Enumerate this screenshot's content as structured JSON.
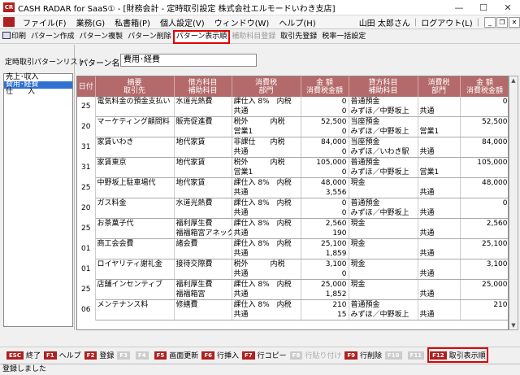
{
  "title": "CASH RADAR for SaaS① - [財務会計 - 定時取引設定 株式会社エルモードいわき支店]",
  "menu": [
    "ファイル(F)",
    "業務(G)",
    "私書箱(P)",
    "個人設定(V)",
    "ウィンドウ(W)",
    "ヘルプ(H)"
  ],
  "user": "山田 太郎さん",
  "logout": "ログアウト(L)",
  "toolbar": [
    {
      "label": "印刷",
      "state": "normal"
    },
    {
      "label": "パターン作成",
      "state": "normal"
    },
    {
      "label": "パターン複製",
      "state": "normal"
    },
    {
      "label": "パターン削除",
      "state": "normal"
    },
    {
      "label": "パターン表示順",
      "state": "highlight"
    },
    {
      "label": "補助科目登録",
      "state": "disabled"
    },
    {
      "label": "取引先登録",
      "state": "normal"
    },
    {
      "label": "税率一括設定",
      "state": "normal"
    }
  ],
  "left_panel": {
    "title": "定時取引パターンリスト",
    "items": [
      {
        "label": "売上･収入",
        "selected": false
      },
      {
        "label": "費用･経費",
        "selected": true
      },
      {
        "label": "仕　　入",
        "selected": false
      }
    ]
  },
  "pattern": {
    "label": "パターン名",
    "value": "費用･経費"
  },
  "table": {
    "headers": [
      {
        "l1": "日付",
        "l2": ""
      },
      {
        "l1": "摘要",
        "l2": "取引先"
      },
      {
        "l1": "借方科目",
        "l2": "補助科目"
      },
      {
        "l1": "消費税",
        "l2": "部門"
      },
      {
        "l1": "金 額",
        "l2": "消費税金額"
      },
      {
        "l1": "貸方科目",
        "l2": "補助科目"
      },
      {
        "l1": "消費税",
        "l2": "部門"
      },
      {
        "l1": "金 額",
        "l2": "消費税金額"
      }
    ],
    "rows": [
      {
        "day": "25",
        "a": [
          "電気料金の預金支払い",
          ""
        ],
        "b": [
          "水道光熱費",
          ""
        ],
        "c": [
          "課仕入 8%　内税",
          "共通"
        ],
        "d": [
          "0",
          "0"
        ],
        "e": [
          "普通預金",
          "みずほ／中野坂上"
        ],
        "f": [
          "",
          "共通"
        ],
        "g": [
          "0",
          ""
        ]
      },
      {
        "day": "20",
        "a": [
          "マーケティング顧問料",
          ""
        ],
        "b": [
          "販売促進費",
          ""
        ],
        "c": [
          "税外　　　内税",
          "営業1"
        ],
        "d": [
          "52,500",
          "0"
        ],
        "e": [
          "当座預金",
          "みずほ／中野坂上"
        ],
        "f": [
          "",
          "営業1"
        ],
        "g": [
          "52,500",
          ""
        ]
      },
      {
        "day": "31",
        "a": [
          "家賃いわき",
          ""
        ],
        "b": [
          "地代家賃",
          ""
        ],
        "c": [
          "非課仕　　内税",
          "共通"
        ],
        "d": [
          "84,000",
          "0"
        ],
        "e": [
          "当座預金",
          "みずほ／いわき駅"
        ],
        "f": [
          "",
          "共通"
        ],
        "g": [
          "84,000",
          ""
        ]
      },
      {
        "day": "31",
        "a": [
          "家賃東京",
          ""
        ],
        "b": [
          "地代家賃",
          ""
        ],
        "c": [
          "税外　　　内税",
          "営業1"
        ],
        "d": [
          "105,000",
          "0"
        ],
        "e": [
          "普通預金",
          "みずほ／中野坂上"
        ],
        "f": [
          "",
          "営業1"
        ],
        "g": [
          "105,000",
          ""
        ]
      },
      {
        "day": "25",
        "a": [
          "中野坂上駐車場代",
          ""
        ],
        "b": [
          "地代家賃",
          ""
        ],
        "c": [
          "課仕入 8%　内税",
          "共通"
        ],
        "d": [
          "48,000",
          "3,556"
        ],
        "e": [
          "現金",
          ""
        ],
        "f": [
          "",
          "共通"
        ],
        "g": [
          "48,000",
          ""
        ]
      },
      {
        "day": "20",
        "a": [
          "ガス料金",
          ""
        ],
        "b": [
          "水道光熱費",
          ""
        ],
        "c": [
          "課仕入 8%　内税",
          "共通"
        ],
        "d": [
          "0",
          "0"
        ],
        "e": [
          "普通預金",
          "みずほ／中野坂上"
        ],
        "f": [
          "",
          "共通"
        ],
        "g": [
          "0",
          ""
        ]
      },
      {
        "day": "25",
        "a": [
          "お茶菓子代",
          ""
        ],
        "b": [
          "福利厚生費",
          "福福箱宮アネックス"
        ],
        "c": [
          "課仕入 8%　内税",
          "共通"
        ],
        "d": [
          "2,560",
          "190"
        ],
        "e": [
          "現金",
          ""
        ],
        "f": [
          "",
          "共通"
        ],
        "g": [
          "2,560",
          ""
        ]
      },
      {
        "day": "01",
        "a": [
          "商工会会費",
          ""
        ],
        "b": [
          "諸会費",
          ""
        ],
        "c": [
          "課仕入 8%　内税",
          "共通"
        ],
        "d": [
          "25,100",
          "1,859"
        ],
        "e": [
          "現金",
          ""
        ],
        "f": [
          "",
          "共通"
        ],
        "g": [
          "25,100",
          ""
        ]
      },
      {
        "day": "01",
        "a": [
          "ロイヤリティ謝礼金",
          ""
        ],
        "b": [
          "接待交際費",
          ""
        ],
        "c": [
          "税外　　　内税",
          "共通"
        ],
        "d": [
          "3,100",
          "0"
        ],
        "e": [
          "現金",
          ""
        ],
        "f": [
          "",
          "共通"
        ],
        "g": [
          "3,100",
          ""
        ]
      },
      {
        "day": "25",
        "a": [
          "店舗インセンティブ",
          ""
        ],
        "b": [
          "福利厚生費",
          "福福箱宮"
        ],
        "c": [
          "課仕入 8%　内税",
          "共通"
        ],
        "d": [
          "25,000",
          "1,852"
        ],
        "e": [
          "現金",
          ""
        ],
        "f": [
          "",
          "共通"
        ],
        "g": [
          "25,000",
          ""
        ]
      },
      {
        "day": "06",
        "a": [
          "メンテナンス料",
          ""
        ],
        "b": [
          "修繕費",
          ""
        ],
        "c": [
          "課仕入 8%　内税",
          "共通"
        ],
        "d": [
          "210",
          "15"
        ],
        "e": [
          "普通預金",
          "みずほ／中野坂上"
        ],
        "f": [
          "",
          "共通"
        ],
        "g": [
          "210",
          ""
        ]
      }
    ]
  },
  "fkeys": [
    {
      "key": "ESC",
      "label": "終了",
      "state": "normal"
    },
    {
      "key": "F1",
      "label": "ヘルプ",
      "state": "normal"
    },
    {
      "key": "F2",
      "label": "登録",
      "state": "normal"
    },
    {
      "key": "F3",
      "label": "",
      "state": "disabled"
    },
    {
      "key": "F4",
      "label": "",
      "state": "disabled"
    },
    {
      "key": "F5",
      "label": "画面更新",
      "state": "normal"
    },
    {
      "key": "F6",
      "label": "行挿入",
      "state": "normal"
    },
    {
      "key": "F7",
      "label": "行コピー",
      "state": "normal"
    },
    {
      "key": "F8",
      "label": "行貼り付け",
      "state": "disabled"
    },
    {
      "key": "F9",
      "label": "行削除",
      "state": "normal"
    },
    {
      "key": "F10",
      "label": "",
      "state": "disabled"
    },
    {
      "key": "F11",
      "label": "",
      "state": "disabled"
    },
    {
      "key": "F12",
      "label": "取引表示順",
      "state": "highlight"
    }
  ],
  "status": "登録しました"
}
